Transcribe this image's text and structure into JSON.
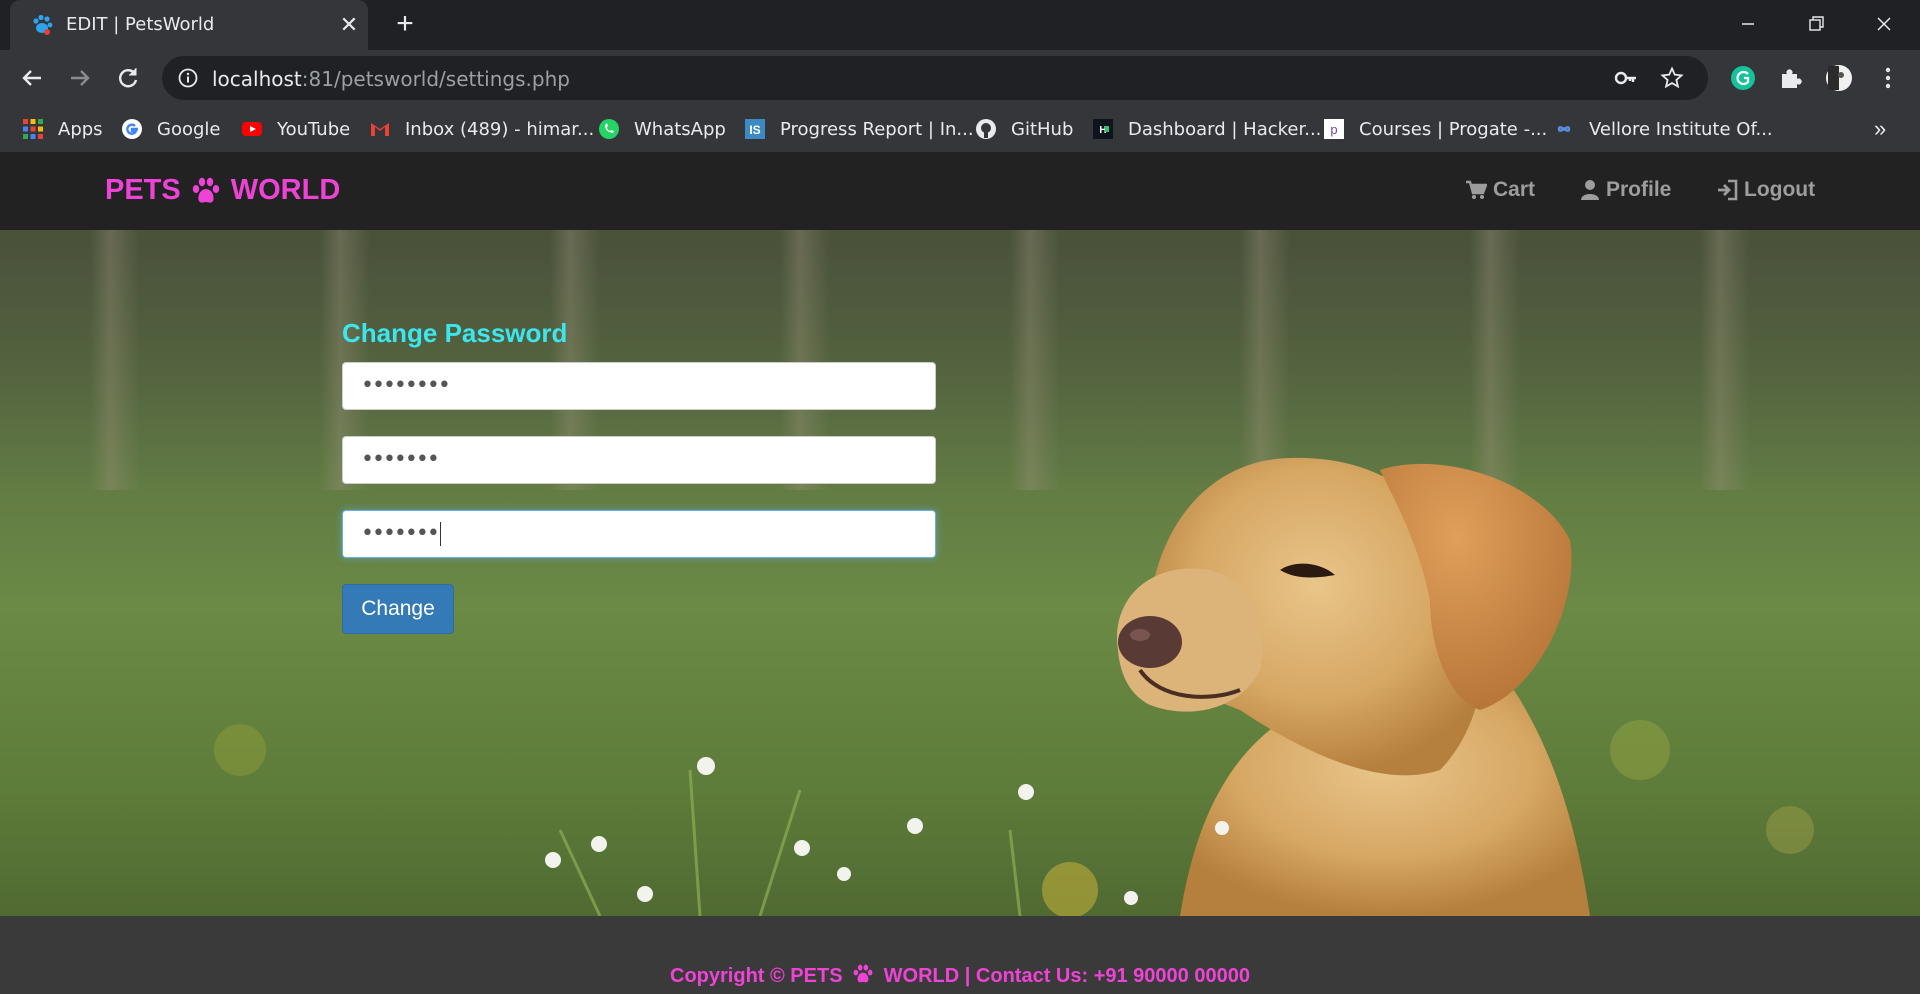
{
  "browser": {
    "tab_title": "EDIT | PetsWorld",
    "url_host": "localhost",
    "url_rest": ":81/petsworld/settings.php",
    "bookmarks": [
      {
        "label": "Apps",
        "icon": "apps-grid-icon"
      },
      {
        "label": "Google",
        "icon": "google-icon"
      },
      {
        "label": "YouTube",
        "icon": "youtube-icon"
      },
      {
        "label": "Inbox (489) - himar...",
        "icon": "gmail-icon"
      },
      {
        "label": "WhatsApp",
        "icon": "whatsapp-icon"
      },
      {
        "label": "Progress Report | In...",
        "icon": "is-icon"
      },
      {
        "label": "GitHub",
        "icon": "github-icon"
      },
      {
        "label": "Dashboard | Hacker...",
        "icon": "hackerrank-icon"
      },
      {
        "label": "Courses | Progate -...",
        "icon": "progate-icon"
      },
      {
        "label": "Vellore Institute Of...",
        "icon": "vit-icon"
      }
    ],
    "more_bookmarks": "»"
  },
  "site": {
    "brand_left": "PETS",
    "brand_right": "WORLD",
    "nav": [
      {
        "label": "Cart",
        "icon": "cart-icon"
      },
      {
        "label": "Profile",
        "icon": "user-icon"
      },
      {
        "label": "Logout",
        "icon": "logout-icon"
      }
    ],
    "form": {
      "title": "Change Password",
      "fields": [
        {
          "masked": "••••••••"
        },
        {
          "masked": "•••••••"
        },
        {
          "masked": "•••••••"
        }
      ],
      "submit": "Change"
    },
    "footer": {
      "before": "Copyright © PETS",
      "after": "WORLD | Contact Us: +91 90000 00000"
    }
  },
  "colors": {
    "brand": "#ee43d6",
    "form_title": "#3ce6ef",
    "button": "#337ab7",
    "navbar": "#222222",
    "footer": "#3a3a3a"
  }
}
